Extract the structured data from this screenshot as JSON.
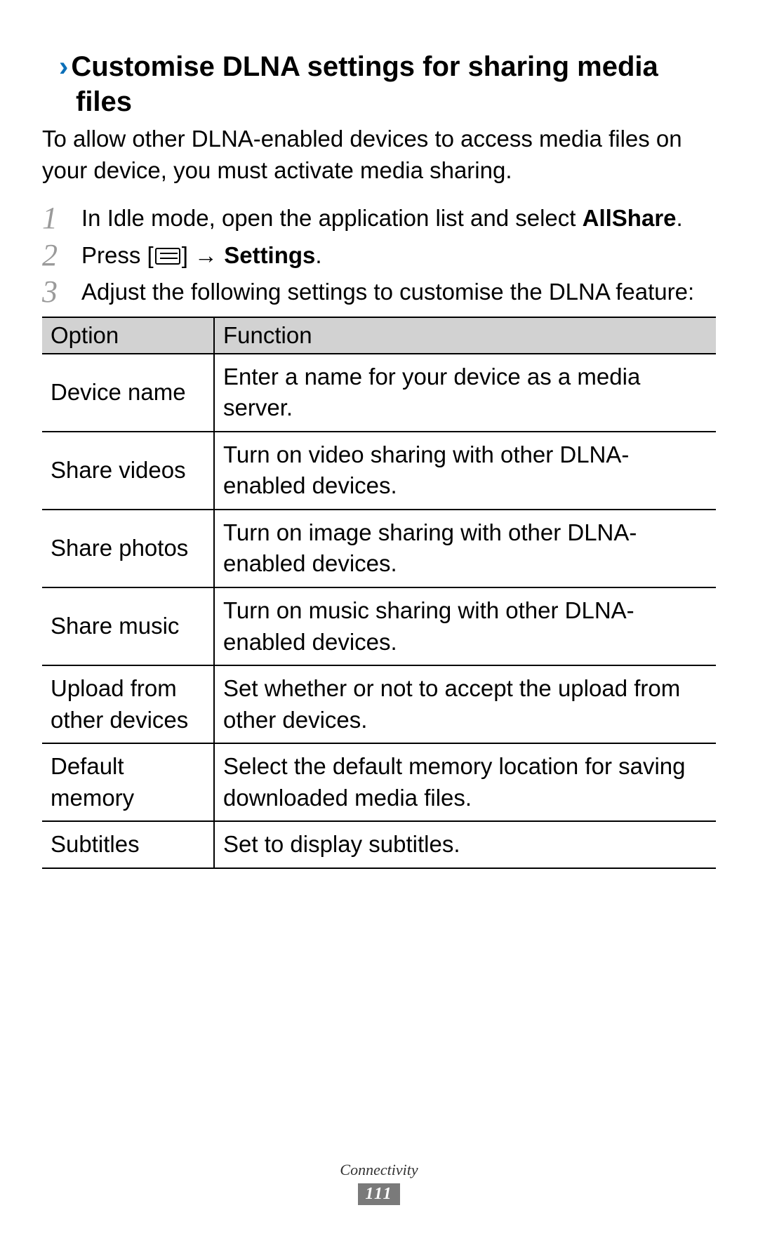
{
  "heading": {
    "chevron": "›",
    "text": "Customise DLNA settings for sharing media files"
  },
  "intro": "To allow other DLNA-enabled devices to access media files on your device, you must activate media sharing.",
  "steps": [
    {
      "num": "1",
      "pre": "In Idle mode, open the application list and select ",
      "bold": "AllShare",
      "post": "."
    },
    {
      "num": "2",
      "pre": "Press [",
      "icon": true,
      "mid": "] → ",
      "bold": "Settings",
      "post": "."
    },
    {
      "num": "3",
      "pre": "Adjust the following settings to customise the DLNA feature:",
      "bold": "",
      "post": ""
    }
  ],
  "table": {
    "headers": {
      "option": "Option",
      "function": "Function"
    },
    "rows": [
      {
        "option": "Device name",
        "function": "Enter a name for your device as a media server."
      },
      {
        "option": "Share videos",
        "function": "Turn on video sharing with other DLNA-enabled devices."
      },
      {
        "option": "Share photos",
        "function": "Turn on image sharing with other DLNA-enabled devices."
      },
      {
        "option": "Share music",
        "function": "Turn on music sharing with other DLNA-enabled devices."
      },
      {
        "option": "Upload from other devices",
        "function": "Set whether or not to accept the upload from other devices."
      },
      {
        "option": "Default memory",
        "function": "Select the default memory location for saving downloaded media files."
      },
      {
        "option": "Subtitles",
        "function": "Set to display subtitles."
      }
    ]
  },
  "footer": {
    "section": "Connectivity",
    "page": "111"
  }
}
